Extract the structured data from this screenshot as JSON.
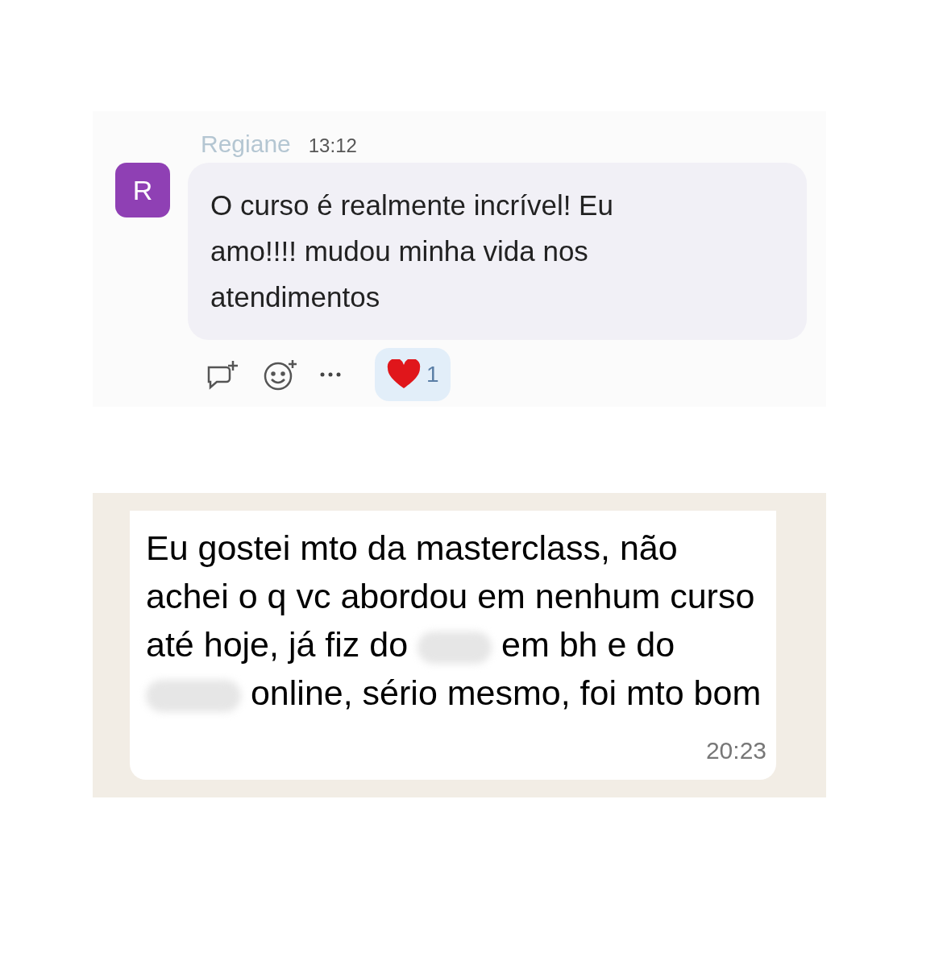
{
  "comment_card": {
    "author": "Regiane",
    "time": "13:12",
    "avatar_letter": "R",
    "message": "O curso é realmente incrível! Eu amo!!!! mudou minha vida nos atendimentos",
    "reactions": [
      {
        "kind": "heart",
        "count": "1",
        "selected": true
      }
    ]
  },
  "chat_message": {
    "segments": [
      {
        "kind": "text",
        "text": "Eu gostei mto da masterclass, não achei o q vc abordou em nenhum curso até hoje, já fiz do"
      },
      {
        "kind": "blurred"
      },
      {
        "kind": "text",
        "text": "em bh e do"
      },
      {
        "kind": "blurred"
      },
      {
        "kind": "text",
        "text": "online, sério mesmo, foi mto bom"
      }
    ],
    "time": "20:23"
  }
}
